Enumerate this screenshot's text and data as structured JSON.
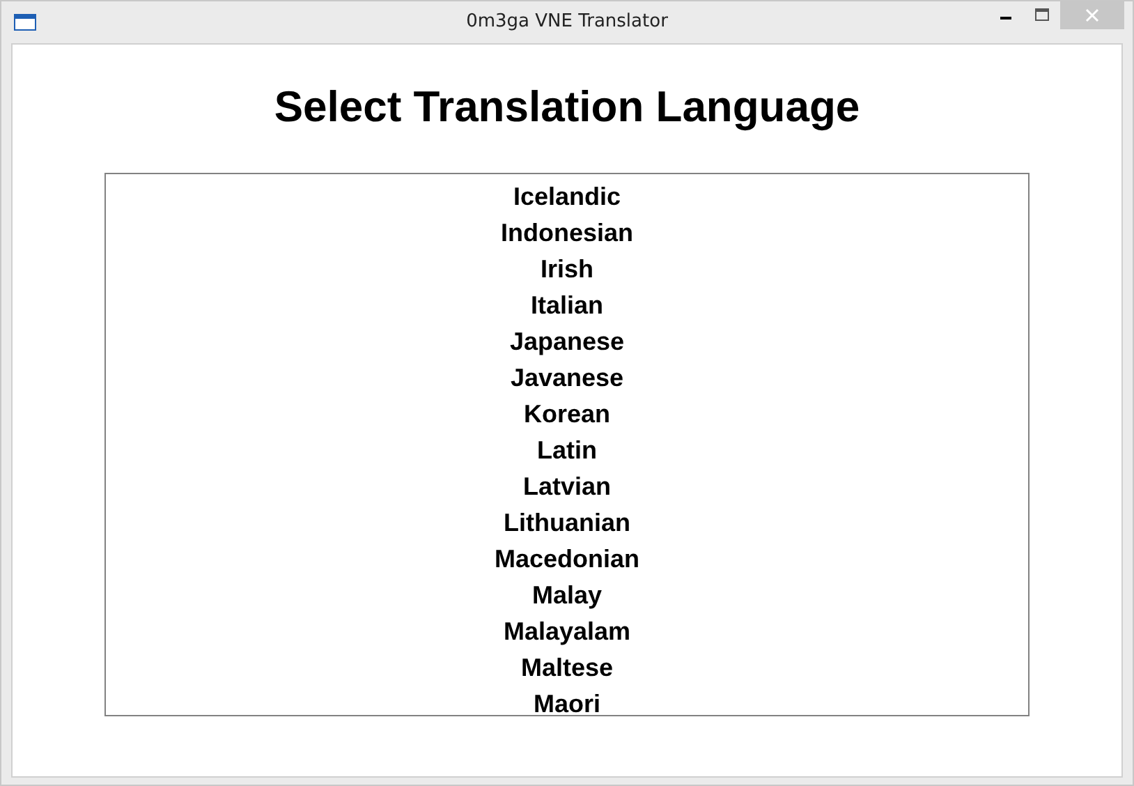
{
  "window": {
    "title": "0m3ga VNE Translator"
  },
  "heading": "Select Translation Language",
  "languages": [
    {
      "label": "Icelandic",
      "selected": false
    },
    {
      "label": "Indonesian",
      "selected": false
    },
    {
      "label": "Irish",
      "selected": false
    },
    {
      "label": "Italian",
      "selected": false
    },
    {
      "label": "Japanese",
      "selected": false
    },
    {
      "label": "Javanese",
      "selected": false
    },
    {
      "label": "Korean",
      "selected": false
    },
    {
      "label": "Latin",
      "selected": false
    },
    {
      "label": "Latvian",
      "selected": false
    },
    {
      "label": "Lithuanian",
      "selected": false
    },
    {
      "label": "Macedonian",
      "selected": false
    },
    {
      "label": "Malay",
      "selected": false
    },
    {
      "label": "Malayalam",
      "selected": false
    },
    {
      "label": "Maltese",
      "selected": false
    },
    {
      "label": "Maori",
      "selected": false
    }
  ]
}
